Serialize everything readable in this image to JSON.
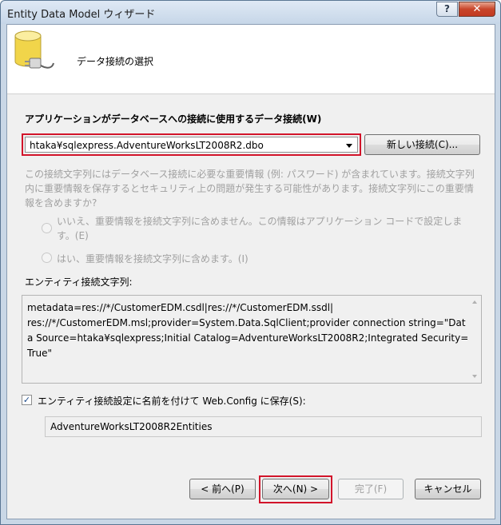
{
  "window": {
    "title": "Entity Data Model ウィザード",
    "help_label": "?",
    "close_label": "x"
  },
  "header": {
    "title": "データ接続の選択",
    "icon": "database-plug-icon"
  },
  "connection": {
    "label": "アプリケーションがデータベースへの接続に使用するデータ接続(W)",
    "selected_value": "htaka¥sqlexpress.AdventureWorksLT2008R2.dbo",
    "new_connection_label": "新しい接続(C)..."
  },
  "sensitive": {
    "description_line1": "この接続文字列にはデータベース接続に必要な重要情報 (例: パスワード) が含まれています。接続文字列",
    "description_line2": "内に重要情報を保存するとセキュリティ上の問題が発生する可能性があります。接続文字列にこの重要情",
    "description_line3": "報を含めますか?",
    "option_no_line1": "いいえ、重要情報を接続文字列に含めません。この情報はアプリケーション コードで設定しま",
    "option_no_line2": "す。(E)",
    "option_yes": "はい、重要情報を接続文字列に含めます。(I)"
  },
  "entity_connection": {
    "label": "エンティティ接続文字列:",
    "value": "metadata=res://*/CustomerEDM.csdl|res://*/CustomerEDM.ssdl|\nres://*/CustomerEDM.msl;provider=System.Data.SqlClient;provider connection string=\"Data Source=htaka¥sqlexpress;Initial Catalog=AdventureWorksLT2008R2;Integrated Security=True\""
  },
  "save": {
    "checkbox_label": "エンティティ接続設定に名前を付けて Web.Config に保存(S):",
    "checked": true,
    "name_value": "AdventureWorksLT2008R2Entities"
  },
  "footer": {
    "back_label": "< 前へ(P)",
    "next_label": "次へ(N) >",
    "finish_label": "完了(F)",
    "cancel_label": "キャンセル"
  },
  "colors": {
    "highlight_frame": "#d2142a",
    "window_frame": "#c9d7e6",
    "client_background": "#f0f0f0"
  }
}
